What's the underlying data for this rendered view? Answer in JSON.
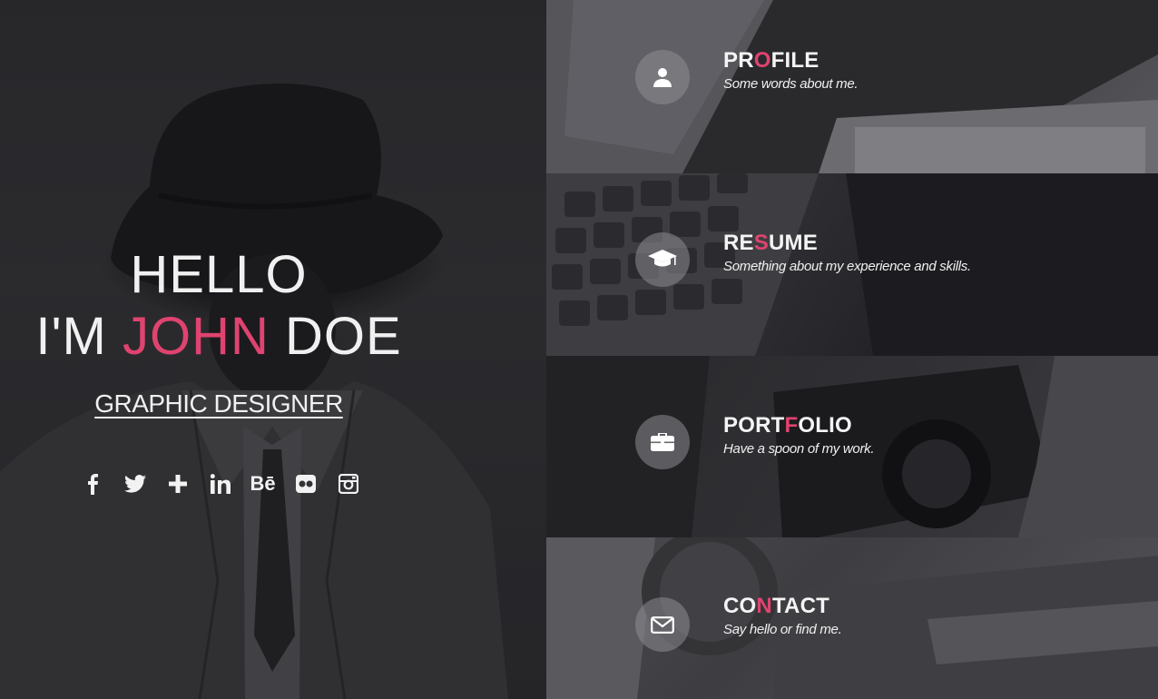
{
  "hero": {
    "greeting": "HELLO",
    "name_prefix": "I'M ",
    "name_highlight": "JOHN",
    "name_suffix": " DOE",
    "role": "GRAPHIC DESIGNER",
    "accent_color": "#e0436f"
  },
  "socials": [
    {
      "name": "facebook",
      "icon": "facebook-icon"
    },
    {
      "name": "twitter",
      "icon": "twitter-icon"
    },
    {
      "name": "google-plus",
      "icon": "plus-icon"
    },
    {
      "name": "linkedin",
      "icon": "linkedin-icon"
    },
    {
      "name": "behance",
      "icon": "behance-icon",
      "glyph": "Bē"
    },
    {
      "name": "flickr",
      "icon": "flickr-icon"
    },
    {
      "name": "instagram",
      "icon": "instagram-icon"
    }
  ],
  "panels": [
    {
      "title_a": "PR",
      "title_accent": "O",
      "title_b": "FILE",
      "subtitle": "Some words about me.",
      "icon": "user-icon"
    },
    {
      "title_a": "RE",
      "title_accent": "S",
      "title_b": "UME",
      "subtitle": "Something about my experience and skills.",
      "icon": "graduation-cap-icon"
    },
    {
      "title_a": "PORT",
      "title_accent": "F",
      "title_b": "OLIO",
      "subtitle": "Have a spoon of my work.",
      "icon": "briefcase-icon"
    },
    {
      "title_a": "CO",
      "title_accent": "N",
      "title_b": "TACT",
      "subtitle": "Say hello or find me.",
      "icon": "envelope-icon"
    }
  ]
}
